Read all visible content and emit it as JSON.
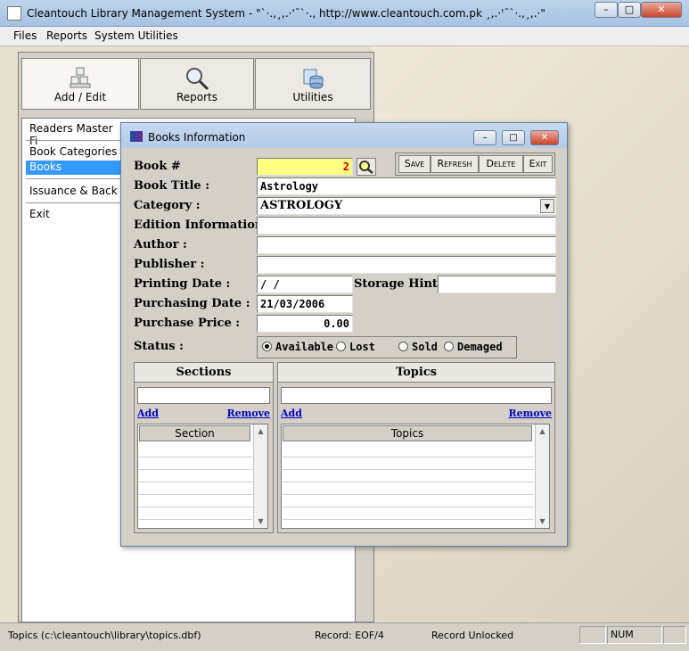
{
  "window": {
    "title": "Cleantouch Library Management System  -  \"`·.,¸,.·'¯`·.,  http://www.cleantouch.com.pk ¸,.·'¯`·.,¸,.·\"",
    "minimize": "–",
    "maximize": "□",
    "close": "✕"
  },
  "menu": {
    "files": "Files",
    "reports": "Reports",
    "system_utilities": "System Utilities"
  },
  "toolbar": {
    "add_edit": "Add / Edit",
    "reports": "Reports",
    "utilities": "Utilities"
  },
  "nav": {
    "readers": "Readers Master Fi",
    "categories": "Book Categories",
    "books": "Books",
    "issuance": "Issuance & Back",
    "exit": "Exit"
  },
  "dialog": {
    "title": "Books Information",
    "buttons": {
      "save": "Save",
      "refresh": "Refresh",
      "delete": "Delete",
      "exit": "Exit"
    },
    "labels": {
      "book_num": "Book #",
      "book_title": "Book Title :",
      "category": "Category :",
      "edition": "Edition Information :",
      "author": "Author :",
      "publisher": "Publisher :",
      "printing_date": "Printing Date :",
      "storage_hint": "Storage Hint :",
      "purchasing_date": "Purchasing Date :",
      "purchase_price": "Purchase Price :",
      "status": "Status :"
    },
    "values": {
      "book_num": "2",
      "book_title": "Astrology",
      "category": "ASTROLOGY",
      "edition": "",
      "author": "",
      "publisher": "",
      "printing_date": " /  /",
      "storage_hint": "",
      "purchasing_date": "21/03/2006",
      "purchase_price": "0.00"
    },
    "status_options": {
      "available": "Available",
      "lost": "Lost",
      "sold": "Sold",
      "demaged": "Demaged",
      "selected": "Available"
    },
    "sections": {
      "title": "Sections",
      "add": "Add",
      "remove": "Remove",
      "column": "Section"
    },
    "topics": {
      "title": "Topics",
      "add": "Add",
      "remove": "Remove",
      "column": "Topics"
    }
  },
  "statusbar": {
    "file": "Topics (c:\\cleantouch\\library\\topics.dbf)",
    "record": "Record: EOF/4",
    "lock": "Record Unlocked",
    "num": "NUM"
  }
}
